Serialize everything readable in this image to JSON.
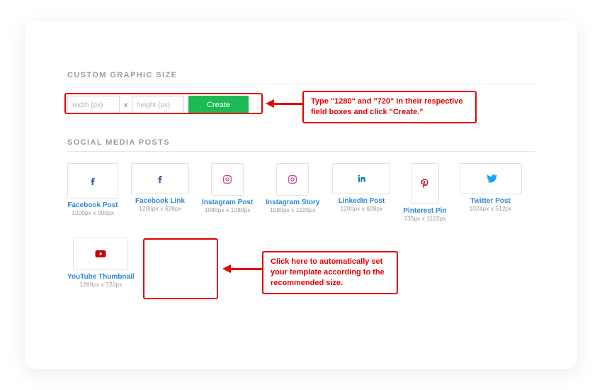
{
  "sections": {
    "customSize": {
      "heading": "CUSTOM GRAPHIC SIZE"
    },
    "social": {
      "heading": "SOCIAL MEDIA POSTS"
    }
  },
  "customSize": {
    "widthPlaceholder": "width (px)",
    "heightPlaceholder": "height (px)",
    "separator": "x",
    "createLabel": "Create"
  },
  "tiles": [
    {
      "key": "fb-post",
      "name": "Facebook Post",
      "dims": "1200px x 900px",
      "icon": "facebook"
    },
    {
      "key": "fb-link",
      "name": "Facebook Link",
      "dims": "1200px x 628px",
      "icon": "facebook"
    },
    {
      "key": "ig-post",
      "name": "Instagram Post",
      "dims": "1080px x 1080px",
      "icon": "instagram"
    },
    {
      "key": "ig-story",
      "name": "Instagram Story",
      "dims": "1080px x 1920px",
      "icon": "instagram"
    },
    {
      "key": "li-post",
      "name": "LinkedIn Post",
      "dims": "1200px x 628px",
      "icon": "linkedin"
    },
    {
      "key": "pt-pin",
      "name": "Pinterest Pin",
      "dims": "735px x 1102px",
      "icon": "pinterest"
    },
    {
      "key": "tw-post",
      "name": "Twitter Post",
      "dims": "1024px x 512px",
      "icon": "twitter"
    },
    {
      "key": "yt-thumb",
      "name": "YouTube Thumbnail",
      "dims": "1280px x 720px",
      "icon": "youtube"
    }
  ],
  "callouts": {
    "top": "Type \"1280\" and \"720\" in their respective field boxes and click \"Create.\"",
    "bottom": "Click here to automatically set your template according to the recommended size."
  }
}
